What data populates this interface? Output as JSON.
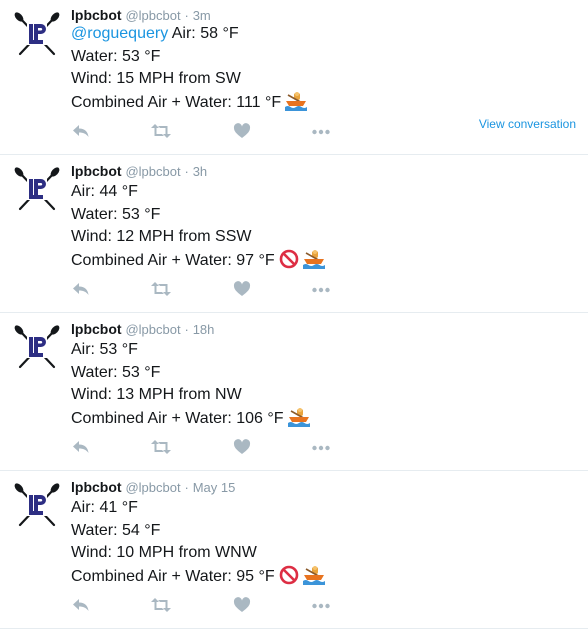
{
  "tweets": [
    {
      "name": "lpbcbot",
      "handle": "@lpbcbot",
      "separator": "·",
      "time": "3m",
      "mention": "@roguequery",
      "air": "Air: 58 °F",
      "water": "Water: 53 °F",
      "wind": "Wind: 15 MPH from SW",
      "combined": "Combined Air + Water: 111 °F",
      "no_entry": false,
      "view_conversation": "View conversation"
    },
    {
      "name": "lpbcbot",
      "handle": "@lpbcbot",
      "separator": "·",
      "time": "3h",
      "air": "Air: 44 °F",
      "water": "Water: 53 °F",
      "wind": "Wind: 12 MPH from SSW",
      "combined": "Combined Air + Water: 97 °F",
      "no_entry": true
    },
    {
      "name": "lpbcbot",
      "handle": "@lpbcbot",
      "separator": "·",
      "time": "18h",
      "air": "Air: 53 °F",
      "water": "Water: 53 °F",
      "wind": "Wind: 13 MPH from NW",
      "combined": "Combined Air + Water: 106 °F",
      "no_entry": false
    },
    {
      "name": "lpbcbot",
      "handle": "@lpbcbot",
      "separator": "·",
      "time": "May 15",
      "air": "Air: 41 °F",
      "water": "Water: 54 °F",
      "wind": "Wind: 10 MPH from WNW",
      "combined": "Combined Air + Water: 95 °F",
      "no_entry": true
    }
  ],
  "icons": {
    "avatar": "crossed-oars-lp-logo",
    "reply": "reply-icon",
    "retweet": "retweet-icon",
    "like": "heart-icon",
    "more": "more-dots-icon",
    "no_entry": "no-entry-icon",
    "rowboat": "rowboat-icon"
  },
  "colors": {
    "text": "#14171a",
    "secondary": "#8899a6",
    "link": "#1b95e0",
    "action_icon": "#aab8c2",
    "divider": "#e6ecf0",
    "logo": "#2d2e83"
  }
}
